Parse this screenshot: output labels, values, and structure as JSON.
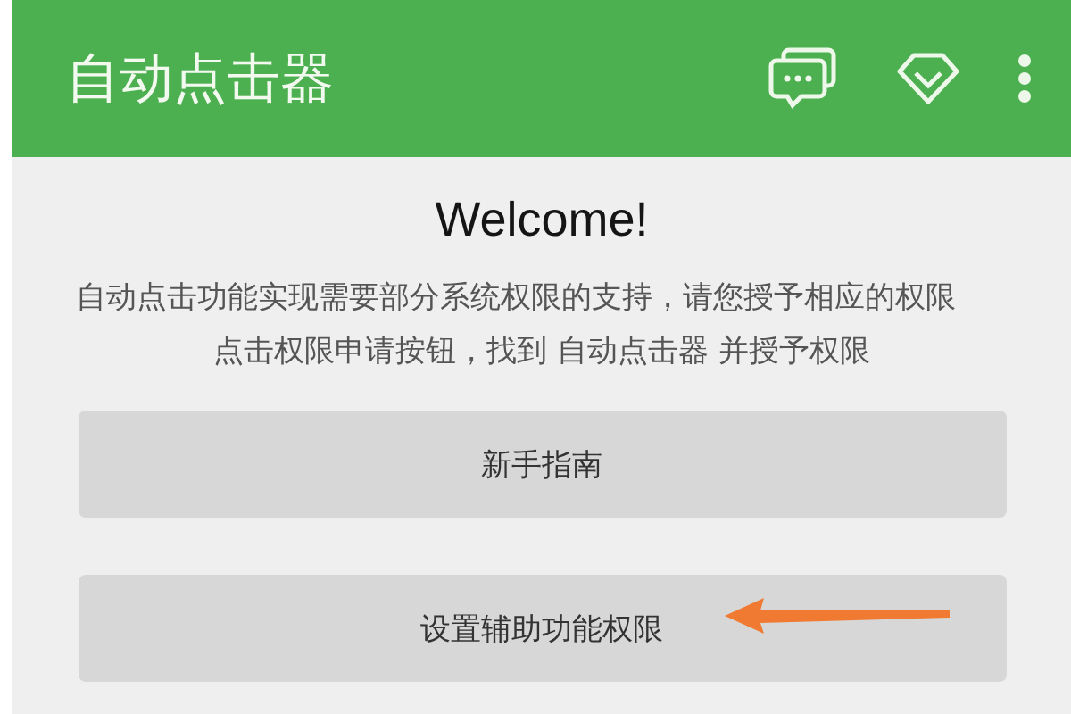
{
  "app_bar": {
    "title": "自动点击器"
  },
  "welcome": {
    "heading": "Welcome!",
    "description": "自动点击功能实现需要部分系统权限的支持，请您授予相应的权限",
    "instruction": "点击权限申请按钮，找到 自动点击器 并授予权限"
  },
  "buttons": [
    {
      "label": "新手指南",
      "annotated": false
    },
    {
      "label": "设置辅助功能权限",
      "annotated": true
    }
  ]
}
